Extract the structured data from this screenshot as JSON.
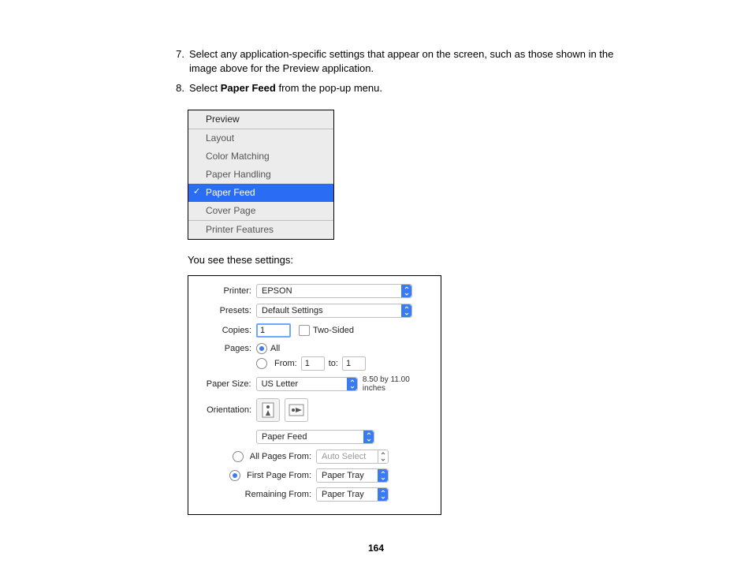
{
  "steps": {
    "n7": "7.",
    "t7": "Select any application-specific settings that appear on the screen, such as those shown in the image above for the Preview application.",
    "n8": "8.",
    "t8a": "Select ",
    "t8b": "Paper Feed",
    "t8c": " from the pop-up menu."
  },
  "popup": {
    "preview": "Preview",
    "layout": "Layout",
    "color_matching": "Color Matching",
    "paper_handling": "Paper Handling",
    "paper_feed": "Paper Feed",
    "cover_page": "Cover Page",
    "printer_features": "Printer Features"
  },
  "lead": "You see these settings:",
  "dialog": {
    "printer_label": "Printer:",
    "printer_value": "EPSON",
    "presets_label": "Presets:",
    "presets_value": "Default Settings",
    "copies_label": "Copies:",
    "copies_value": "1",
    "two_sided": "Two-Sided",
    "pages_label": "Pages:",
    "all": "All",
    "from": "From:",
    "from_value": "1",
    "to": "to:",
    "to_value": "1",
    "paper_size_label": "Paper Size:",
    "paper_size_value": "US Letter",
    "paper_size_note": "8.50 by 11.00 inches",
    "orientation_label": "Orientation:",
    "section_select": "Paper Feed",
    "all_pages_from": "All Pages From:",
    "all_pages_value": "Auto Select",
    "first_page_from": "First Page From:",
    "first_page_value": "Paper Tray",
    "remaining_from": "Remaining From:",
    "remaining_value": "Paper Tray"
  },
  "page_number": "164"
}
